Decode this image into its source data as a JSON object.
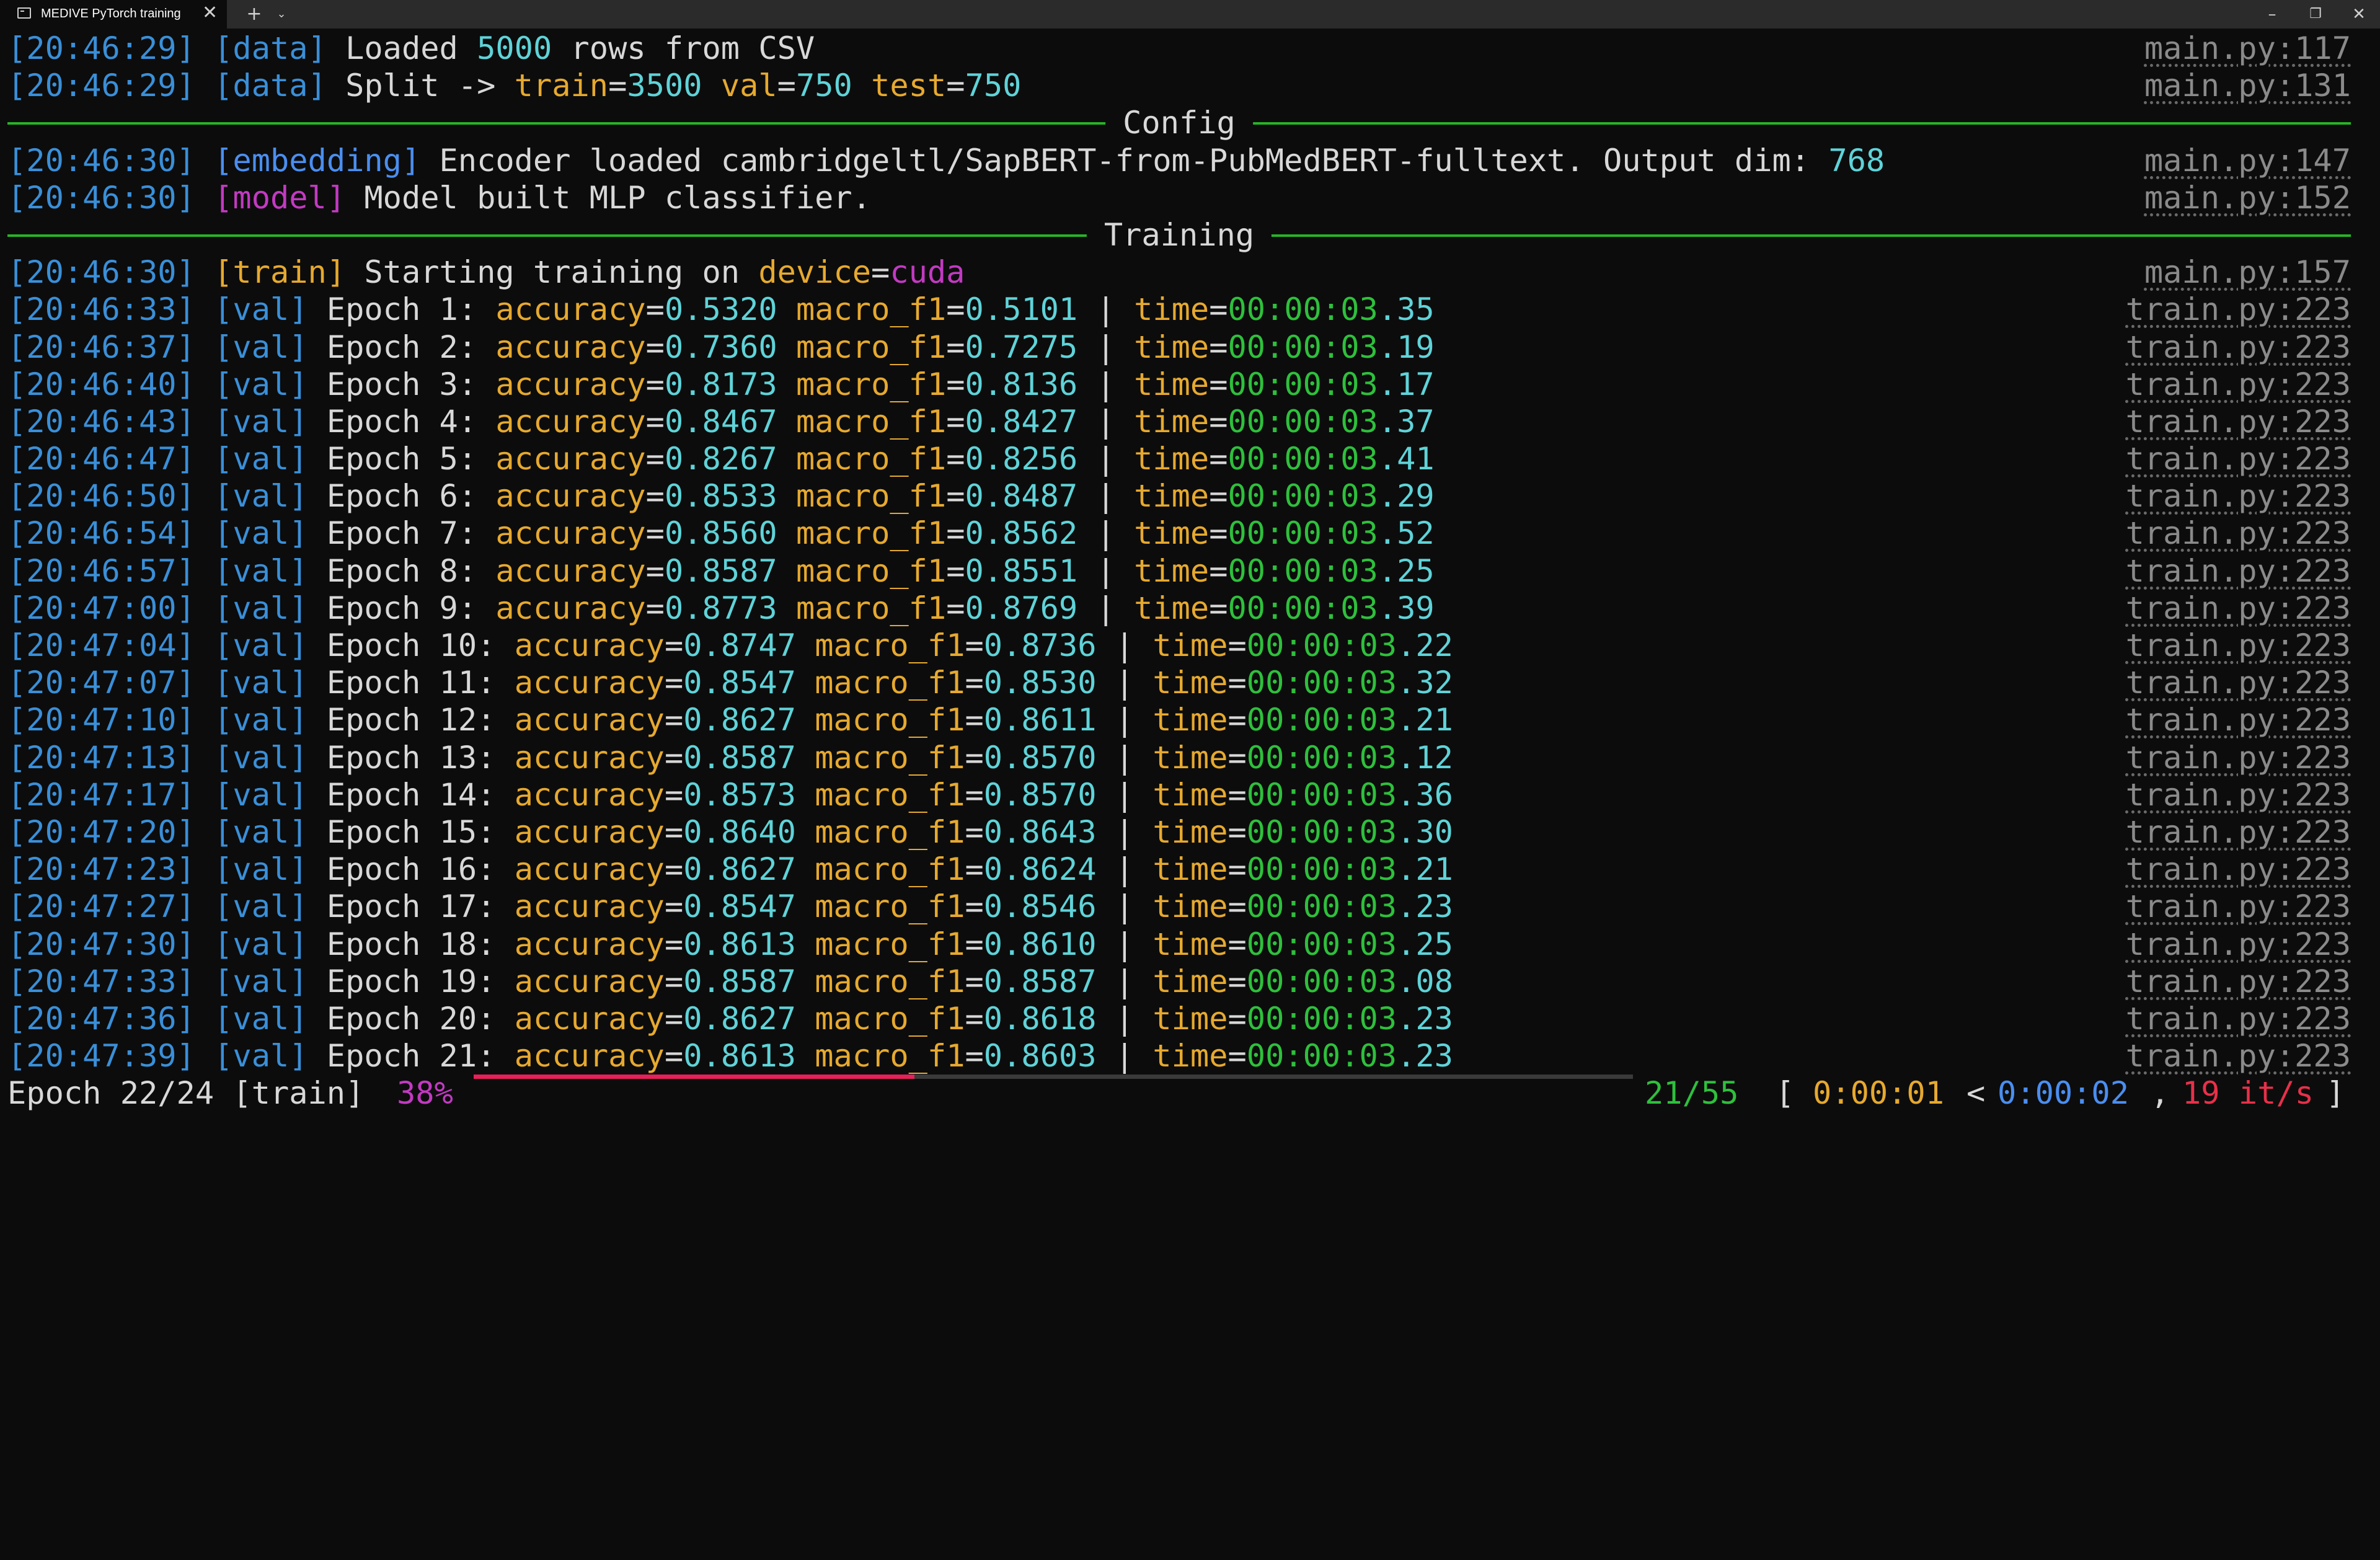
{
  "window": {
    "tab_title": "MEDIVE PyTorch training",
    "tab_close": "✕",
    "new_tab": "+",
    "tab_menu": "⌄",
    "minimize": "–",
    "maximize": "❐",
    "close": "✕"
  },
  "colors": {
    "timestamp": "#3a8fd8",
    "data_tag": "#3a8fd8",
    "embedding_tag": "#4a8ef0",
    "model_tag": "#c23ac2",
    "train_tag": "#e6a92f",
    "metric_name": "#e6a92f",
    "metric_value": "#5fd3d8",
    "time_value": "#2ec03c",
    "rule": "#26b526",
    "progress_fill": "#e8205a"
  },
  "log": {
    "data_load": {
      "time": "[20:46:29]",
      "tag": "[data]",
      "text1": " Loaded ",
      "rows": "5000",
      "text2": " rows from CSV",
      "file": "main.py:117"
    },
    "data_split": {
      "time": "[20:46:29]",
      "tag": "[data]",
      "text1": " Split -> ",
      "k1": "train",
      "eq": "=",
      "v1": "3500",
      "k2": "val",
      "v2": "750",
      "k3": "test",
      "v3": "750",
      "file": "main.py:131"
    },
    "rule_config": "Config",
    "embedding": {
      "time": "[20:46:30]",
      "tag": "[embedding]",
      "text": " Encoder loaded cambridgeltl/SapBERT-from-PubMedBERT-fulltext. Output dim: ",
      "dim": "768",
      "file": "main.py:147"
    },
    "model": {
      "time": "[20:46:30]",
      "tag": "[model]",
      "text": " Model built MLP classifier.",
      "file": "main.py:152"
    },
    "rule_training": "Training",
    "train_start": {
      "time": "[20:46:30]",
      "tag": "[train]",
      "text": " Starting training on ",
      "key": "device",
      "eq": "=",
      "value": "cuda",
      "file": "main.py:157"
    }
  },
  "epochs": [
    {
      "time": "[20:46:33]",
      "epoch": "1",
      "acc": "0.5320",
      "f1": "0.5101",
      "tv": "00:00:03",
      "td": ".35"
    },
    {
      "time": "[20:46:37]",
      "epoch": "2",
      "acc": "0.7360",
      "f1": "0.7275",
      "tv": "00:00:03",
      "td": ".19"
    },
    {
      "time": "[20:46:40]",
      "epoch": "3",
      "acc": "0.8173",
      "f1": "0.8136",
      "tv": "00:00:03",
      "td": ".17"
    },
    {
      "time": "[20:46:43]",
      "epoch": "4",
      "acc": "0.8467",
      "f1": "0.8427",
      "tv": "00:00:03",
      "td": ".37"
    },
    {
      "time": "[20:46:47]",
      "epoch": "5",
      "acc": "0.8267",
      "f1": "0.8256",
      "tv": "00:00:03",
      "td": ".41"
    },
    {
      "time": "[20:46:50]",
      "epoch": "6",
      "acc": "0.8533",
      "f1": "0.8487",
      "tv": "00:00:03",
      "td": ".29"
    },
    {
      "time": "[20:46:54]",
      "epoch": "7",
      "acc": "0.8560",
      "f1": "0.8562",
      "tv": "00:00:03",
      "td": ".52"
    },
    {
      "time": "[20:46:57]",
      "epoch": "8",
      "acc": "0.8587",
      "f1": "0.8551",
      "tv": "00:00:03",
      "td": ".25"
    },
    {
      "time": "[20:47:00]",
      "epoch": "9",
      "acc": "0.8773",
      "f1": "0.8769",
      "tv": "00:00:03",
      "td": ".39"
    },
    {
      "time": "[20:47:04]",
      "epoch": "10",
      "acc": "0.8747",
      "f1": "0.8736",
      "tv": "00:00:03",
      "td": ".22"
    },
    {
      "time": "[20:47:07]",
      "epoch": "11",
      "acc": "0.8547",
      "f1": "0.8530",
      "tv": "00:00:03",
      "td": ".32"
    },
    {
      "time": "[20:47:10]",
      "epoch": "12",
      "acc": "0.8627",
      "f1": "0.8611",
      "tv": "00:00:03",
      "td": ".21"
    },
    {
      "time": "[20:47:13]",
      "epoch": "13",
      "acc": "0.8587",
      "f1": "0.8570",
      "tv": "00:00:03",
      "td": ".12"
    },
    {
      "time": "[20:47:17]",
      "epoch": "14",
      "acc": "0.8573",
      "f1": "0.8570",
      "tv": "00:00:03",
      "td": ".36"
    },
    {
      "time": "[20:47:20]",
      "epoch": "15",
      "acc": "0.8640",
      "f1": "0.8643",
      "tv": "00:00:03",
      "td": ".30"
    },
    {
      "time": "[20:47:23]",
      "epoch": "16",
      "acc": "0.8627",
      "f1": "0.8624",
      "tv": "00:00:03",
      "td": ".21"
    },
    {
      "time": "[20:47:27]",
      "epoch": "17",
      "acc": "0.8547",
      "f1": "0.8546",
      "tv": "00:00:03",
      "td": ".23"
    },
    {
      "time": "[20:47:30]",
      "epoch": "18",
      "acc": "0.8613",
      "f1": "0.8610",
      "tv": "00:00:03",
      "td": ".25"
    },
    {
      "time": "[20:47:33]",
      "epoch": "19",
      "acc": "0.8587",
      "f1": "0.8587",
      "tv": "00:00:03",
      "td": ".08"
    },
    {
      "time": "[20:47:36]",
      "epoch": "20",
      "acc": "0.8627",
      "f1": "0.8618",
      "tv": "00:00:03",
      "td": ".23"
    },
    {
      "time": "[20:47:39]",
      "epoch": "21",
      "acc": "0.8613",
      "f1": "0.8603",
      "tv": "00:00:03",
      "td": ".23"
    }
  ],
  "epoch_labels": {
    "tag": "[val]",
    "word": " Epoch ",
    "colon": ": ",
    "acc_key": "accuracy",
    "f1_key": " macro_f1",
    "eq": "=",
    "sep": " | ",
    "time_key": "time",
    "file": "train.py:223"
  },
  "progress": {
    "label": "Epoch 22/24 [train]",
    "percent_text": "38%",
    "fraction": 0.38,
    "count": "21/55",
    "open": "[",
    "elapsed": "0:00:01",
    "lt": "<",
    "remaining": "0:00:02",
    "comma": ",",
    "rate": "19 it/s",
    "close": "]"
  }
}
